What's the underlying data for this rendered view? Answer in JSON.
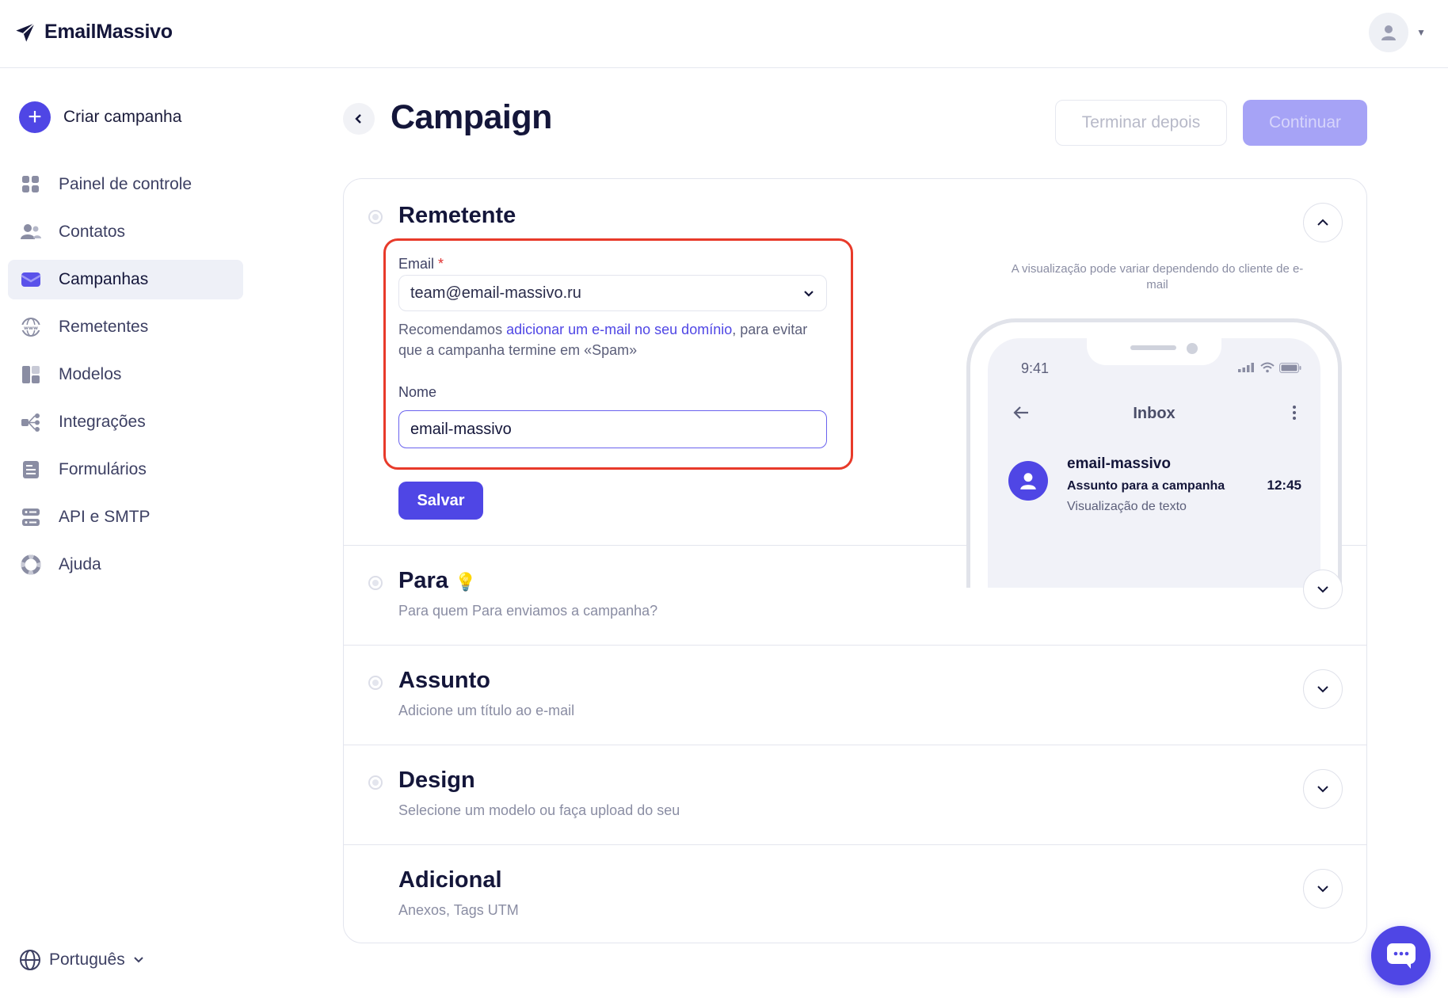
{
  "app": {
    "name": "EmailMassivo"
  },
  "sidebar": {
    "create_label": "Criar campanha",
    "items": [
      {
        "label": "Painel de controle",
        "icon": "dashboard-icon"
      },
      {
        "label": "Contatos",
        "icon": "contacts-icon"
      },
      {
        "label": "Campanhas",
        "icon": "campaigns-icon",
        "active": true
      },
      {
        "label": "Remetentes",
        "icon": "www-icon"
      },
      {
        "label": "Modelos",
        "icon": "templates-icon"
      },
      {
        "label": "Integrações",
        "icon": "integrations-icon"
      },
      {
        "label": "Formulários",
        "icon": "forms-icon"
      },
      {
        "label": "API e SMTP",
        "icon": "server-icon"
      },
      {
        "label": "Ajuda",
        "icon": "help-icon"
      }
    ],
    "language": "Português"
  },
  "main": {
    "title": "Campaign",
    "finish_later": "Terminar depois",
    "continue": "Continuar"
  },
  "sender": {
    "title": "Remetente",
    "email_label": "Email",
    "email_required": "*",
    "email_value": "team@email-massivo.ru",
    "hint_before": "Recomendamos ",
    "hint_link": "adicionar um e-mail no seu domínio",
    "hint_after": ", para evitar que a campanha termine em «Spam»",
    "name_label": "Nome",
    "name_value": "email-massivo",
    "save": "Salvar"
  },
  "preview": {
    "note": "A visualização pode variar dependendo do cliente de e-mail",
    "time": "9:41",
    "inbox_title": "Inbox",
    "from": "email-massivo",
    "subject": "Assunto para a campanha",
    "preview_text": "Visualização de texto",
    "mail_time": "12:45"
  },
  "sections": [
    {
      "title": "Para",
      "subtitle": "Para quem Para enviamos a campanha?",
      "emoji": "💡"
    },
    {
      "title": "Assunto",
      "subtitle": "Adicione um título ao e-mail"
    },
    {
      "title": "Design",
      "subtitle": "Selecione um modelo ou faça upload do seu"
    },
    {
      "title": "Adicional",
      "subtitle": "Anexos, Tags UTM"
    }
  ],
  "colors": {
    "accent": "#4f46e5",
    "highlight": "#e83a2a"
  }
}
